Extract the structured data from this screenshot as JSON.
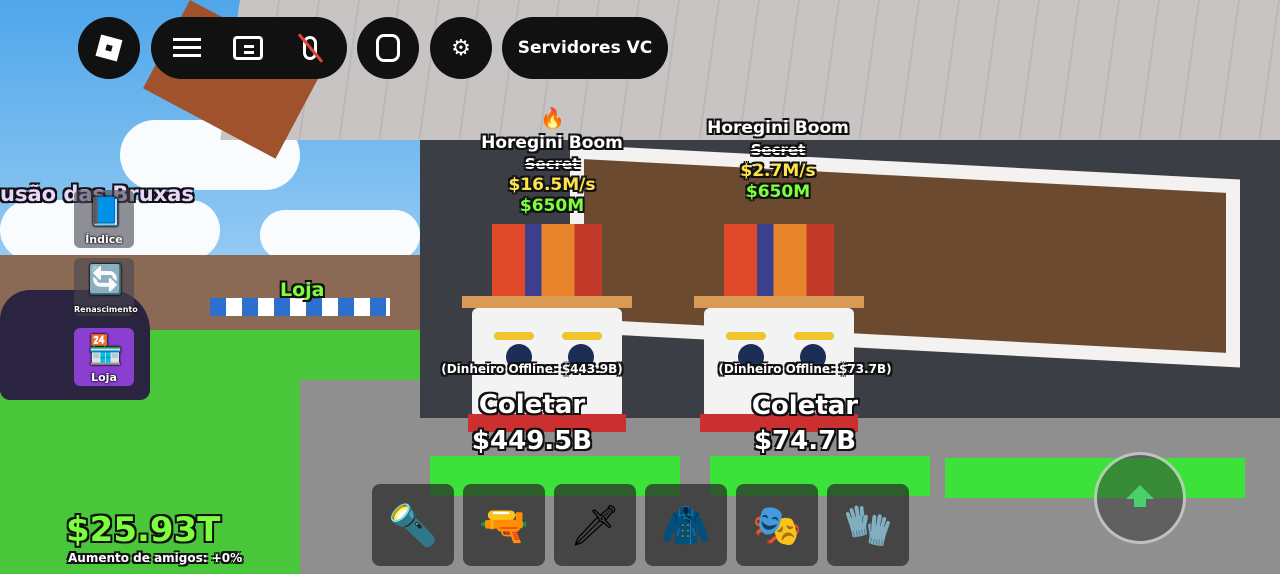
{
  "topbar": {
    "roblox_menu": "roblox-logo-icon",
    "menu_icon": "hamburger-icon",
    "chat_icon": "chat-icon",
    "mic_icon": "mic-muted-icon",
    "backpack_icon": "backpack-icon",
    "settings_icon": "gear-icon",
    "voice_servers_label": "Servidores VC"
  },
  "side_menu": {
    "fusion_title": "usão das Bruxas",
    "index_label": "Índice",
    "rebirth_label": "Renascimento",
    "shop_label": "Loja"
  },
  "world_labels": {
    "shop_sign": "Loja",
    "fire_icon": "fire-icon"
  },
  "brainrots": [
    {
      "name": "Horegini Boom",
      "rarity": "Secret",
      "income": "$16.5M/s",
      "price": "$650M",
      "offline_money": "(Dinheiro Offline: $443.9B)",
      "collect_label": "Coletar",
      "collect_amount": "$449.5B"
    },
    {
      "name": "Horegini Boom",
      "rarity": "Secret",
      "income": "$2.7M/s",
      "price": "$650M",
      "offline_money": "(Dinheiro Offline: $73.7B)",
      "collect_label": "Coletar",
      "collect_amount": "$74.7B"
    }
  ],
  "hud": {
    "money": "$25.93T",
    "friends_boost": "Aumento de amigos: +0%"
  },
  "hotbar": [
    {
      "icon": "flashlight-tool-icon"
    },
    {
      "icon": "blue-orange-blaster-icon"
    },
    {
      "icon": "rainbow-sword-icon"
    },
    {
      "icon": "dark-cloak-icon"
    },
    {
      "icon": "green-mask-icon"
    },
    {
      "icon": "blue-gauntlet-icon"
    }
  ],
  "jump_icon": "jump-arrow-icon",
  "colors": {
    "income_yellow": "#ffe34a",
    "price_green": "#7cff3d",
    "money_green": "#7cff3d",
    "jump_green": "#4ad06a"
  }
}
